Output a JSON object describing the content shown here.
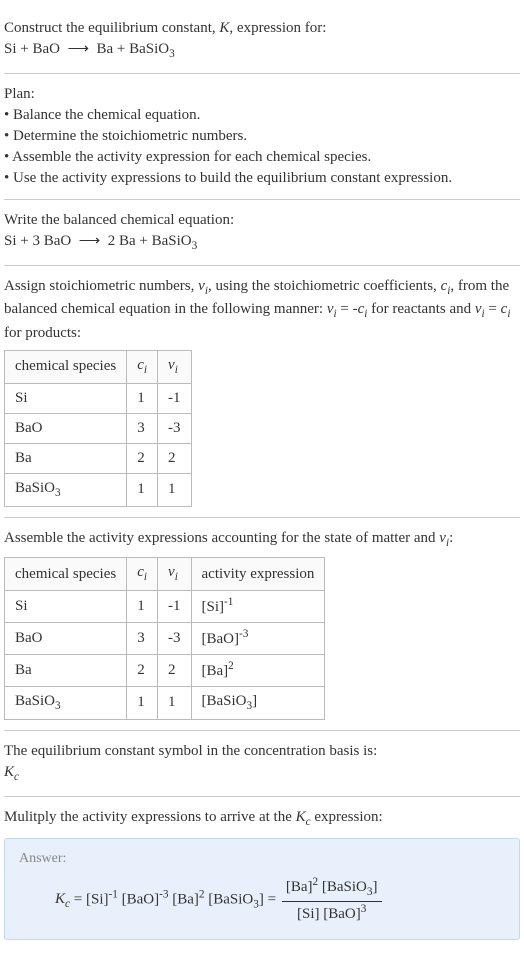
{
  "header": {
    "prompt_line1": "Construct the equilibrium constant, K, expression for:",
    "reaction_unbalanced": "Si + BaO ⟶ Ba + BaSiO₃"
  },
  "plan": {
    "title": "Plan:",
    "steps": [
      "• Balance the chemical equation.",
      "• Determine the stoichiometric numbers.",
      "• Assemble the activity expression for each chemical species.",
      "• Use the activity expressions to build the equilibrium constant expression."
    ]
  },
  "balanced": {
    "intro": "Write the balanced chemical equation:",
    "equation": "Si + 3 BaO ⟶ 2 Ba + BaSiO₃"
  },
  "stoich": {
    "intro": "Assign stoichiometric numbers, νᵢ, using the stoichiometric coefficients, cᵢ, from the balanced chemical equation in the following manner: νᵢ = -cᵢ for reactants and νᵢ = cᵢ for products:",
    "headers": {
      "species": "chemical species",
      "ci": "cᵢ",
      "vi": "νᵢ"
    },
    "rows": [
      {
        "species": "Si",
        "ci": "1",
        "vi": "-1"
      },
      {
        "species": "BaO",
        "ci": "3",
        "vi": "-3"
      },
      {
        "species": "Ba",
        "ci": "2",
        "vi": "2"
      },
      {
        "species": "BaSiO₃",
        "ci": "1",
        "vi": "1"
      }
    ]
  },
  "activity": {
    "intro": "Assemble the activity expressions accounting for the state of matter and νᵢ:",
    "headers": {
      "species": "chemical species",
      "ci": "cᵢ",
      "vi": "νᵢ",
      "expr": "activity expression"
    },
    "rows": [
      {
        "species": "Si",
        "ci": "1",
        "vi": "-1",
        "expr": "[Si]⁻¹"
      },
      {
        "species": "BaO",
        "ci": "3",
        "vi": "-3",
        "expr": "[BaO]⁻³"
      },
      {
        "species": "Ba",
        "ci": "2",
        "vi": "2",
        "expr": "[Ba]²"
      },
      {
        "species": "BaSiO₃",
        "ci": "1",
        "vi": "1",
        "expr": "[BaSiO₃]"
      }
    ]
  },
  "kc_symbol": {
    "intro": "The equilibrium constant symbol in the concentration basis is:",
    "symbol": "K_c"
  },
  "final": {
    "intro": "Mulitply the activity expressions to arrive at the K_c expression:",
    "answer_label": "Answer:",
    "lhs": "K_c = [Si]⁻¹ [BaO]⁻³ [Ba]² [BaSiO₃] = ",
    "frac_num": "[Ba]² [BaSiO₃]",
    "frac_den": "[Si] [BaO]³"
  }
}
